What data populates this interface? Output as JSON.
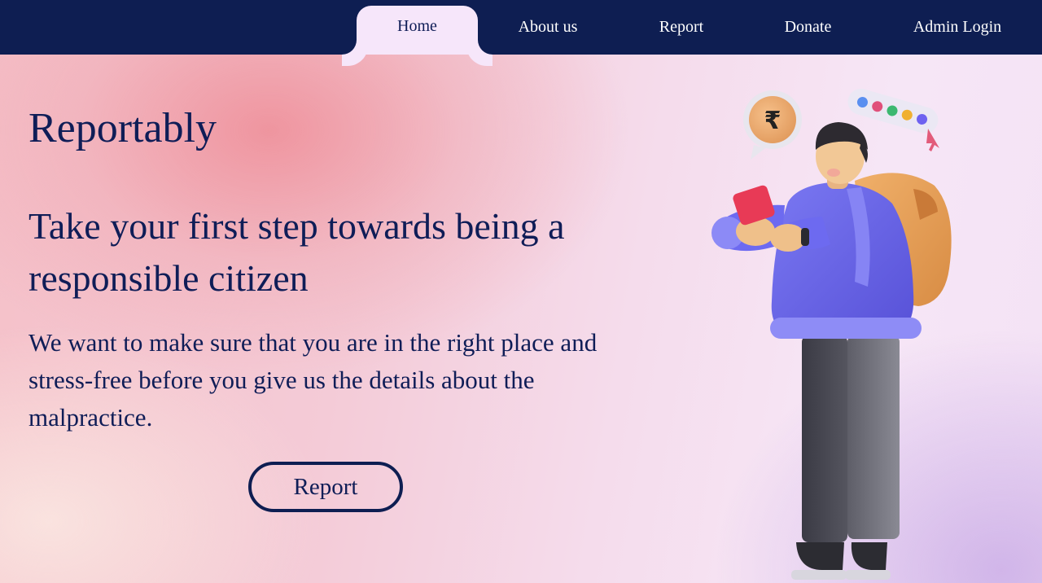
{
  "nav": {
    "items": [
      {
        "label": "Home",
        "active": true
      },
      {
        "label": "About us",
        "active": false
      },
      {
        "label": "Report",
        "active": false
      },
      {
        "label": "Donate",
        "active": false
      },
      {
        "label": "Admin Login",
        "active": false
      }
    ]
  },
  "hero": {
    "brand": "Reportably",
    "headline": "Take your first step towards being a responsible citizen",
    "description": "We want to make sure that you are in the right place and stress-free before you give us the details about the malpractice.",
    "cta_label": "Report"
  },
  "illustration": {
    "icon": "person-with-phone-and-backpack-illustration",
    "currency_symbol": "₹"
  },
  "colors": {
    "navy": "#0e1e52",
    "text": "#0f1d57",
    "active_tab": "#f6e6fa"
  }
}
